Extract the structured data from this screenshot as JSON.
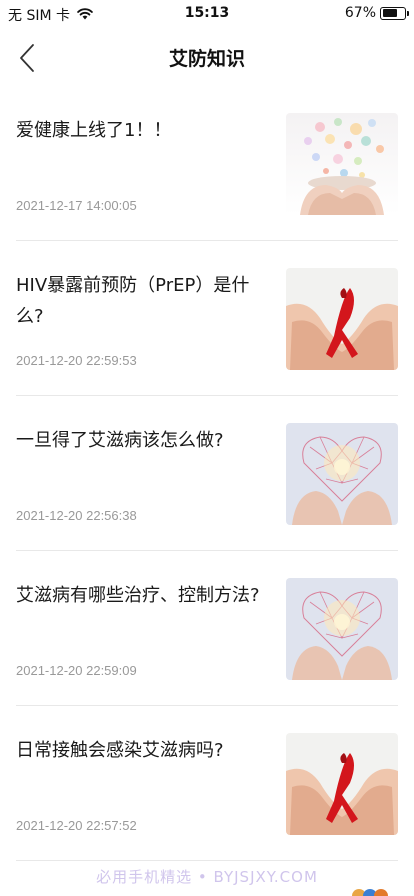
{
  "status_bar": {
    "carrier": "无 SIM 卡",
    "time": "15:13",
    "battery_percent": "67%",
    "battery_level": 0.67
  },
  "nav": {
    "title": "艾防知识"
  },
  "articles": [
    {
      "title": "爱健康上线了1！！",
      "date": "2021-12-17 14:00:05",
      "thumb": "pills-in-hands"
    },
    {
      "title": "HIV暴露前预防（PrEP）是什么?",
      "date": "2021-12-20 22:59:53",
      "thumb": "red-ribbon-hands"
    },
    {
      "title": "一旦得了艾滋病该怎么做?",
      "date": "2021-12-20 22:56:38",
      "thumb": "network-heart-hands"
    },
    {
      "title": "艾滋病有哪些治疗、控制方法?",
      "date": "2021-12-20 22:59:09",
      "thumb": "network-heart-hands"
    },
    {
      "title": "日常接触会感染艾滋病吗?",
      "date": "2021-12-20 22:57:52",
      "thumb": "red-ribbon-hands"
    }
  ],
  "watermark": "必用手机精选 • BYJSJXY.COM"
}
